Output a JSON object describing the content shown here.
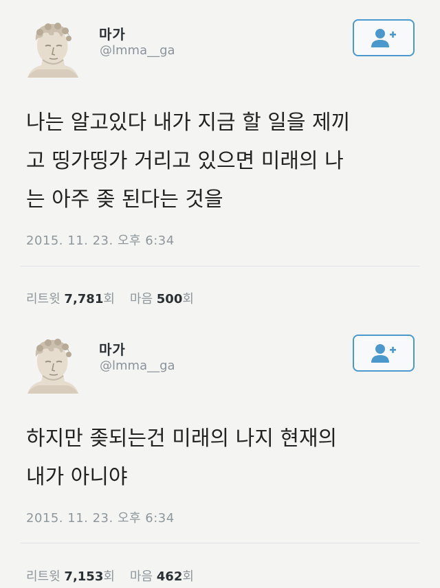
{
  "tweets": [
    {
      "display_name": "마가",
      "username": "@lmma__ga",
      "text_lines": [
        "나는 알고있다 내가 지금 할 일을 제끼",
        "고 띵가띵가 거리고 있으면 미래의 나",
        "는 아주 좆 된다는 것을"
      ],
      "timestamp": "2015. 11. 23. 오후 6:34",
      "retweet_label": "리트윗",
      "retweet_count": "7,781",
      "retweet_unit": "회",
      "like_label": "마음",
      "like_count": "500",
      "like_unit": "회"
    },
    {
      "display_name": "마가",
      "username": "@lmma__ga",
      "text_lines": [
        "하지만 좆되는건 미래의 나지 현재의",
        "내가 아니야"
      ],
      "timestamp": "2015. 11. 23. 오후 6:34",
      "retweet_label": "리트윗",
      "retweet_count": "7,153",
      "retweet_unit": "회",
      "like_label": "마음",
      "like_count": "462",
      "like_unit": "회"
    }
  ],
  "icons": {
    "avatar": "bust-statue-icon",
    "follow": "add-user-icon"
  },
  "colors": {
    "follow_blue": "#4a98cc",
    "muted_text": "#8f979c",
    "background": "#f4f4f2"
  }
}
